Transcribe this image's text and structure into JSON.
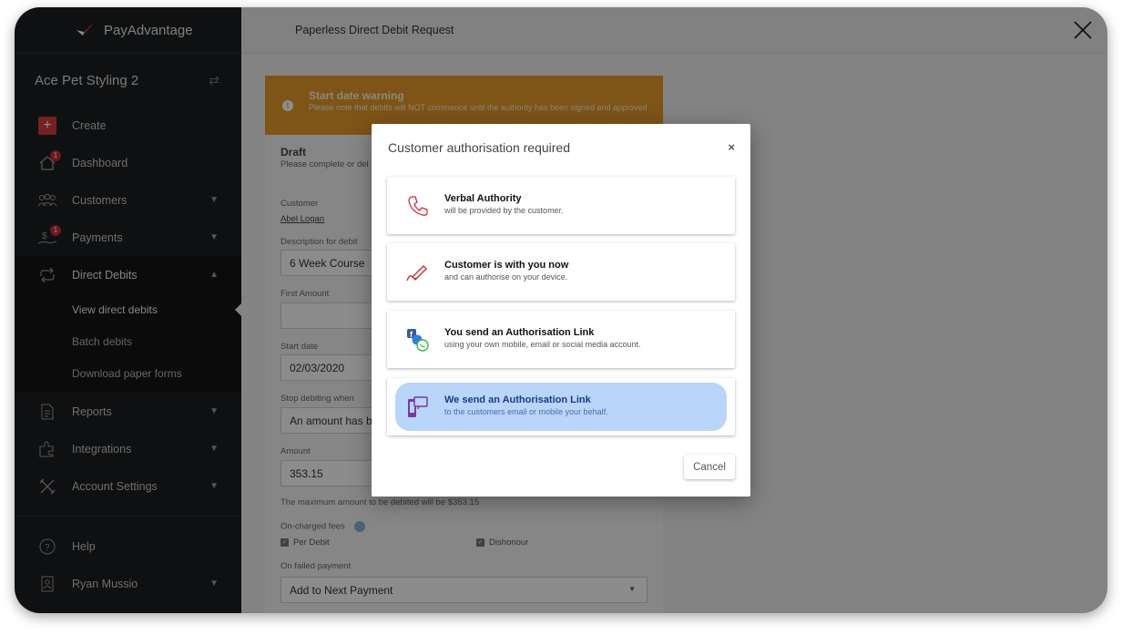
{
  "brand": {
    "name": "PayAdvantage"
  },
  "sidebar": {
    "org_name": "Ace Pet Styling 2",
    "items": [
      {
        "label": "Create",
        "icon": "plus-icon"
      },
      {
        "label": "Dashboard",
        "icon": "home-icon",
        "badge": "1"
      },
      {
        "label": "Customers",
        "icon": "users-icon"
      },
      {
        "label": "Payments",
        "icon": "payment-icon",
        "badge": "1"
      },
      {
        "label": "Direct Debits",
        "icon": "repeat-icon"
      },
      {
        "label": "Reports",
        "icon": "document-icon"
      },
      {
        "label": "Integrations",
        "icon": "puzzle-icon"
      },
      {
        "label": "Account Settings",
        "icon": "tools-icon"
      },
      {
        "label": "Help",
        "icon": "help-icon"
      },
      {
        "label": "Ryan Mussio",
        "icon": "user-badge-icon"
      }
    ],
    "sub_items": [
      {
        "label": "View direct debits"
      },
      {
        "label": "Batch debits"
      },
      {
        "label": "Download paper forms"
      }
    ]
  },
  "header": {
    "title": "Paperless Direct Debit Request"
  },
  "form": {
    "warning_title": "Start date warning",
    "warning_text": "Please note that debits will NOT commence until the authority has been signed and approved",
    "status": "Draft",
    "status_sub": "Please complete or del",
    "customer_label": "Customer",
    "customer_value": "Abel Logan",
    "description_label": "Description for debit",
    "description_value": "6 Week Course",
    "first_amount_label": "First Amount",
    "first_amount_value": "",
    "start_date_label": "Start date",
    "start_date_value": "02/03/2020",
    "stop_label": "Stop debiting when",
    "stop_value": "An amount has be",
    "amount_label": "Amount",
    "amount_value": "353.15",
    "max_note": "The maximum amount to be debited will be $353.15",
    "fees_label": "On-charged fees",
    "fee_per_debit": "Per Debit",
    "fee_dishonour": "Dishonour",
    "failed_label": "On failed payment",
    "failed_value": "Add to Next Payment"
  },
  "modal": {
    "title": "Customer authorisation required",
    "close": "×",
    "options": [
      {
        "title": "Verbal Authority",
        "subtitle": "will be provided by the customer.",
        "icon": "phone-icon"
      },
      {
        "title": "Customer is with you now",
        "subtitle": "and can authorise on your device.",
        "icon": "pen-icon"
      },
      {
        "title": "You send an Authorisation Link",
        "subtitle": "using your own mobile, email or social media account.",
        "icon": "social-apps-icon"
      },
      {
        "title": "We send an Authorisation Link",
        "subtitle": "to the customers email or mobile your behalf.",
        "icon": "devices-icon"
      }
    ],
    "selected_index": 3,
    "cancel_label": "Cancel"
  },
  "colors": {
    "accent": "#d33d3d",
    "warning": "#e59a2a",
    "selected": "#b9d5f9"
  }
}
